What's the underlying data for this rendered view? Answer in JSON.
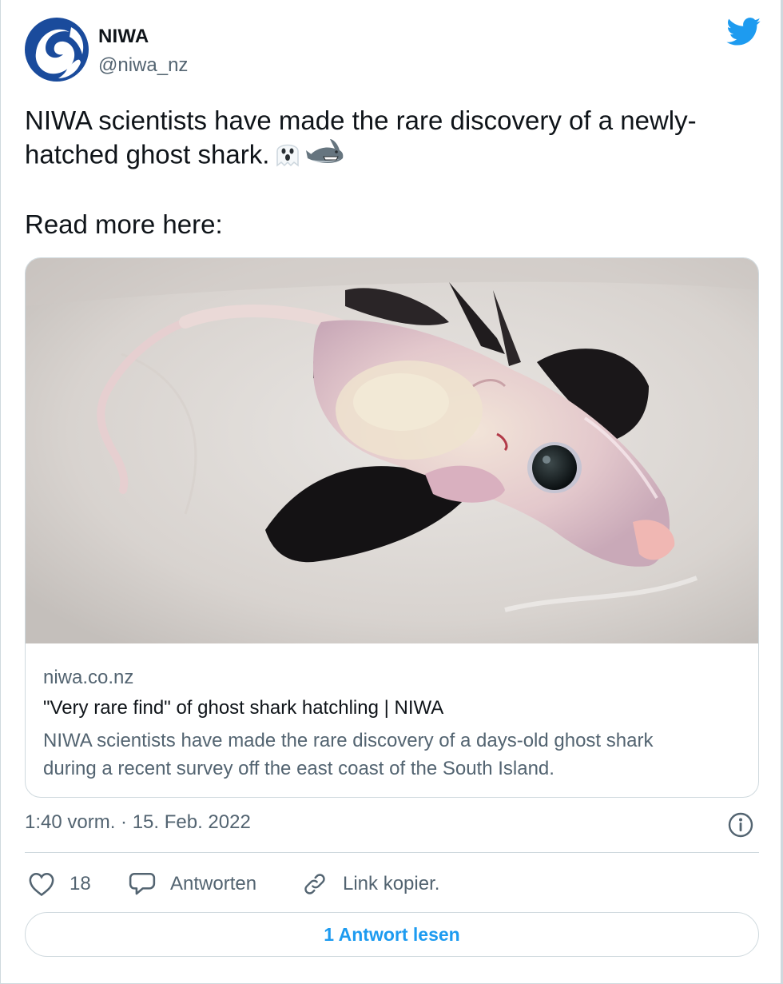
{
  "author": {
    "name": "NIWA",
    "handle": "@niwa_nz",
    "avatar_icon": "niwa-logo",
    "verified_icon": "twitter-bird-icon"
  },
  "tweet": {
    "line1": "NIWA scientists have made the rare discovery of a newly-",
    "line2": "hatched ghost shark.",
    "emojis": [
      "ghost-emoji",
      "shark-emoji"
    ],
    "read_more": "Read more here:"
  },
  "link_card": {
    "image_icon": "ghost-shark-photo",
    "domain": "niwa.co.nz",
    "title": "\"Very rare find\" of ghost shark hatchling | NIWA",
    "description_line1": "NIWA scientists have made the rare discovery of a days-old ghost shark",
    "description_line2": "during a recent survey off the east coast of the South Island."
  },
  "meta": {
    "timestamp": "1:40 vorm. · 15. Feb. 2022"
  },
  "actions": {
    "like_count": "18",
    "reply_label": "Antworten",
    "copy_label": "Link kopier."
  },
  "read_replies": "1 Antwort lesen",
  "colors": {
    "accent": "#1d9bf0",
    "text": "#0f1419",
    "secondary": "#536471",
    "border": "#cfd9de",
    "brand_blue": "#1a4b9c"
  }
}
